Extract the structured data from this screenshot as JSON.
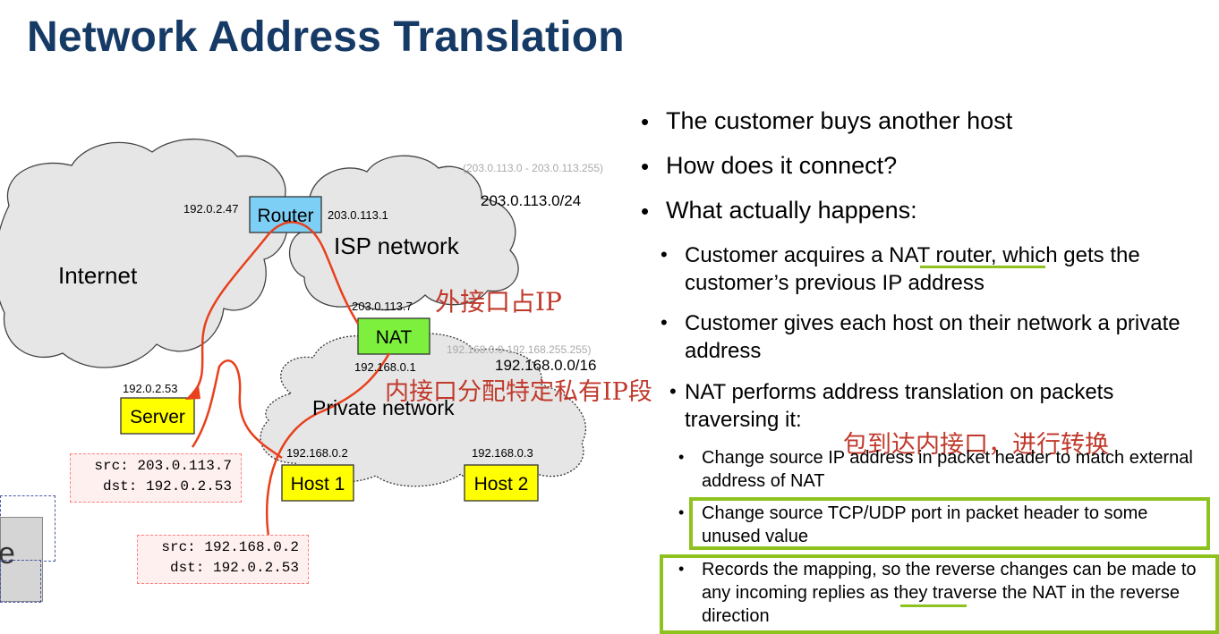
{
  "title": "Network Address Translation",
  "diagram": {
    "clouds": {
      "internet": "Internet",
      "isp": "ISP network",
      "private": "Private network"
    },
    "nodes": {
      "router": "Router",
      "nat": "NAT",
      "server": "Server",
      "host1": "Host 1",
      "host2": "Host 2"
    },
    "addresses": {
      "router_left": "192.0.2.47",
      "router_right": "203.0.113.1",
      "isp_range": "(203.0.113.0 - 203.0.113.255)",
      "isp_prefix": "203.0.113.0/24",
      "nat_outer": "203.0.113.7",
      "private_range": "192.168.0.0-192.168.255.255)",
      "private_prefix": "192.168.0.0/16",
      "nat_inner": "192.168.0.1",
      "server_ip": "192.0.2.53",
      "host1_ip": "192.168.0.2",
      "host2_ip": "192.168.0.3"
    },
    "packets": {
      "outer_src": "src: 203.0.113.7",
      "outer_dst": "dst: 192.0.2.53",
      "inner_src": "src: 192.168.0.2",
      "inner_dst": "dst: 192.0.2.53"
    },
    "partial_glyph": "e"
  },
  "annotations": {
    "outer_interface": "外接口占IP",
    "inner_interface": "内接口分配特定私有IP段",
    "translate": "包到达内接口，进行转换"
  },
  "bullets": {
    "l1": [
      "The customer buys another host",
      "How does it connect?",
      "What actually happens:"
    ],
    "l2": [
      "Customer acquires a NAT router, which gets the customer’s previous IP address",
      "Customer gives each host on their network a private address",
      "NAT performs address translation on packets traversing it:"
    ],
    "l3": [
      "Change source IP address in packet header to match external address of NAT",
      "Change source TCP/UDP port in packet header to some unused value",
      "Records the mapping, so the reverse changes can be made to any incoming replies as they traverse the NAT in the reverse direction"
    ]
  },
  "colors": {
    "title": "#163a66",
    "router": "#7ecff5",
    "nat": "#7cf03c",
    "host": "#ffff00",
    "path": "#e8401c",
    "highlight": "#8dc21f",
    "annotation": "#c0392b"
  }
}
